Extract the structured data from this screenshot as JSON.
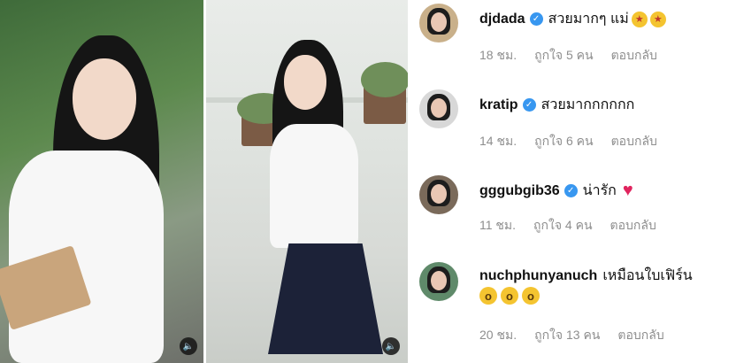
{
  "photos": [
    {
      "name": "student-photo-left"
    },
    {
      "name": "student-photo-right"
    }
  ],
  "sound_icon": "🔈",
  "comments": [
    {
      "username": "djdada",
      "verified": true,
      "text": "สวยมากๆ แม่",
      "emojis": [
        "star-struck",
        "star-struck"
      ],
      "time": "18 ชม.",
      "likes": "ถูกใจ 5 คน",
      "reply": "ตอบกลับ",
      "avatar_bg": "#c9b08a"
    },
    {
      "username": "kratip",
      "verified": true,
      "text": "สวยมากกกกกก",
      "emojis": [],
      "time": "14 ชม.",
      "likes": "ถูกใจ 6 คน",
      "reply": "ตอบกลับ",
      "avatar_bg": "#d8d8d8"
    },
    {
      "username": "gggubgib36",
      "verified": true,
      "text": "น่ารัก",
      "emojis": [
        "red-heart"
      ],
      "time": "11 ชม.",
      "likes": "ถูกใจ 4 คน",
      "reply": "ตอบกลับ",
      "avatar_bg": "#7a6a5a"
    },
    {
      "username": "nuchphunyanuch",
      "verified": false,
      "text": "เหมือนใบเฟิร์น",
      "emojis": [
        "astonished",
        "astonished",
        "astonished"
      ],
      "time": "20 ชม.",
      "likes": "ถูกใจ 13 คน",
      "reply": "ตอบกลับ",
      "avatar_bg": "#5f8a6a"
    }
  ],
  "colors": {
    "verified_blue": "#3897f0",
    "meta_gray": "#8e8e8e",
    "heart_red": "#e0245e"
  }
}
